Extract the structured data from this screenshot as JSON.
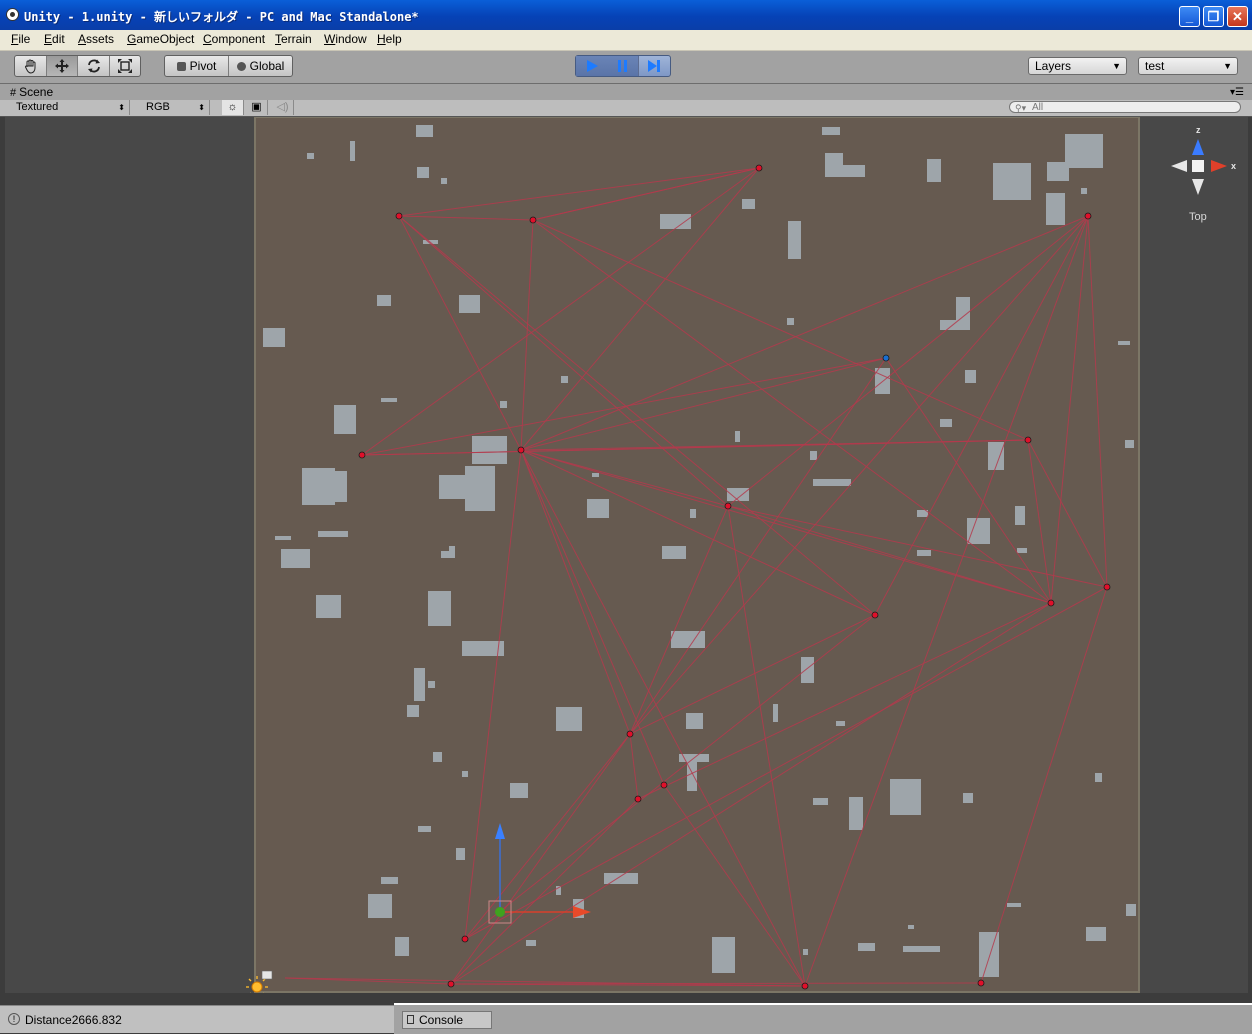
{
  "window": {
    "title": "Unity - 1.unity - 新しいフォルダ - PC and Mac Standalone*",
    "controls": [
      "_",
      "❐",
      "✕"
    ]
  },
  "menu": [
    "File",
    "Edit",
    "Assets",
    "GameObject",
    "Component",
    "Terrain",
    "Window",
    "Help"
  ],
  "toolbar": {
    "tools": [
      "hand-icon",
      "move-icon",
      "rotate-icon",
      "scale-icon"
    ],
    "pivot_label": "Pivot",
    "global_label": "Global",
    "layers_label": "Layers",
    "layout_label": "test"
  },
  "scene_tab": {
    "label": "Scene",
    "render_mode": "Textured",
    "color_mode": "RGB",
    "search_placeholder": "All"
  },
  "gizmo": {
    "view_label": "Top",
    "z_label": "z",
    "x_label": "x"
  },
  "status": {
    "text": "Distance2666.832"
  },
  "console": {
    "label": "Console"
  },
  "colors": {
    "ground": "#665a50",
    "obstacle": "#9ea5aa",
    "link_line": "#b43a4c",
    "node": "#e0102a",
    "goal_node": "#1a6fd1"
  }
}
